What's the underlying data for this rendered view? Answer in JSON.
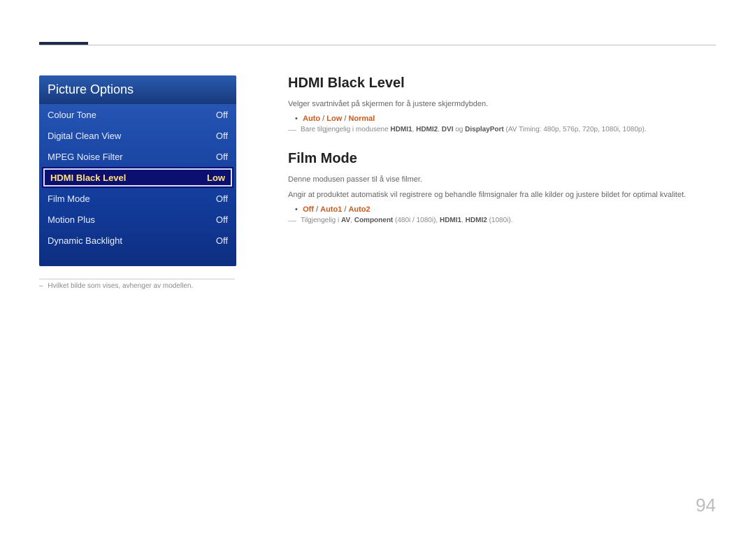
{
  "menu": {
    "title": "Picture Options",
    "items": [
      {
        "label": "Colour Tone",
        "value": "Off",
        "selected": false
      },
      {
        "label": "Digital Clean View",
        "value": "Off",
        "selected": false
      },
      {
        "label": "MPEG Noise Filter",
        "value": "Off",
        "selected": false
      },
      {
        "label": "HDMI Black Level",
        "value": "Low",
        "selected": true
      },
      {
        "label": "Film Mode",
        "value": "Off",
        "selected": false
      },
      {
        "label": "Motion Plus",
        "value": "Off",
        "selected": false
      },
      {
        "label": "Dynamic Backlight",
        "value": "Off",
        "selected": false
      }
    ]
  },
  "footnote_left": "Hvilket bilde som vises, avhenger av modellen.",
  "sections": {
    "hdmi": {
      "title": "HDMI Black Level",
      "desc": "Velger svartnivået på skjermen for å justere skjermdybden.",
      "options": [
        "Auto",
        "Low",
        "Normal"
      ],
      "note_prefix": "Bare tilgjengelig i modusene ",
      "note_bold": [
        "HDMI1",
        "HDMI2",
        "DVI"
      ],
      "note_conj": " og ",
      "note_bold2": "DisplayPort",
      "note_suffix": " (AV Timing: 480p, 576p, 720p, 1080i, 1080p)."
    },
    "film": {
      "title": "Film Mode",
      "desc1": "Denne modusen passer til å vise filmer.",
      "desc2": "Angir at produktet automatisk vil registrere og behandle filmsignaler fra alle kilder og justere bildet for optimal kvalitet.",
      "options": [
        "Off",
        "Auto1",
        "Auto2"
      ],
      "note_prefix": "Tilgjengelig i ",
      "note_parts": [
        {
          "text": "AV",
          "bold": true
        },
        {
          "text": ", "
        },
        {
          "text": "Component",
          "bold": true
        },
        {
          "text": " (480i / 1080i), "
        },
        {
          "text": "HDMI1",
          "bold": true
        },
        {
          "text": ", "
        },
        {
          "text": "HDMI2",
          "bold": true
        },
        {
          "text": " (1080i)."
        }
      ]
    }
  },
  "page_number": "94"
}
